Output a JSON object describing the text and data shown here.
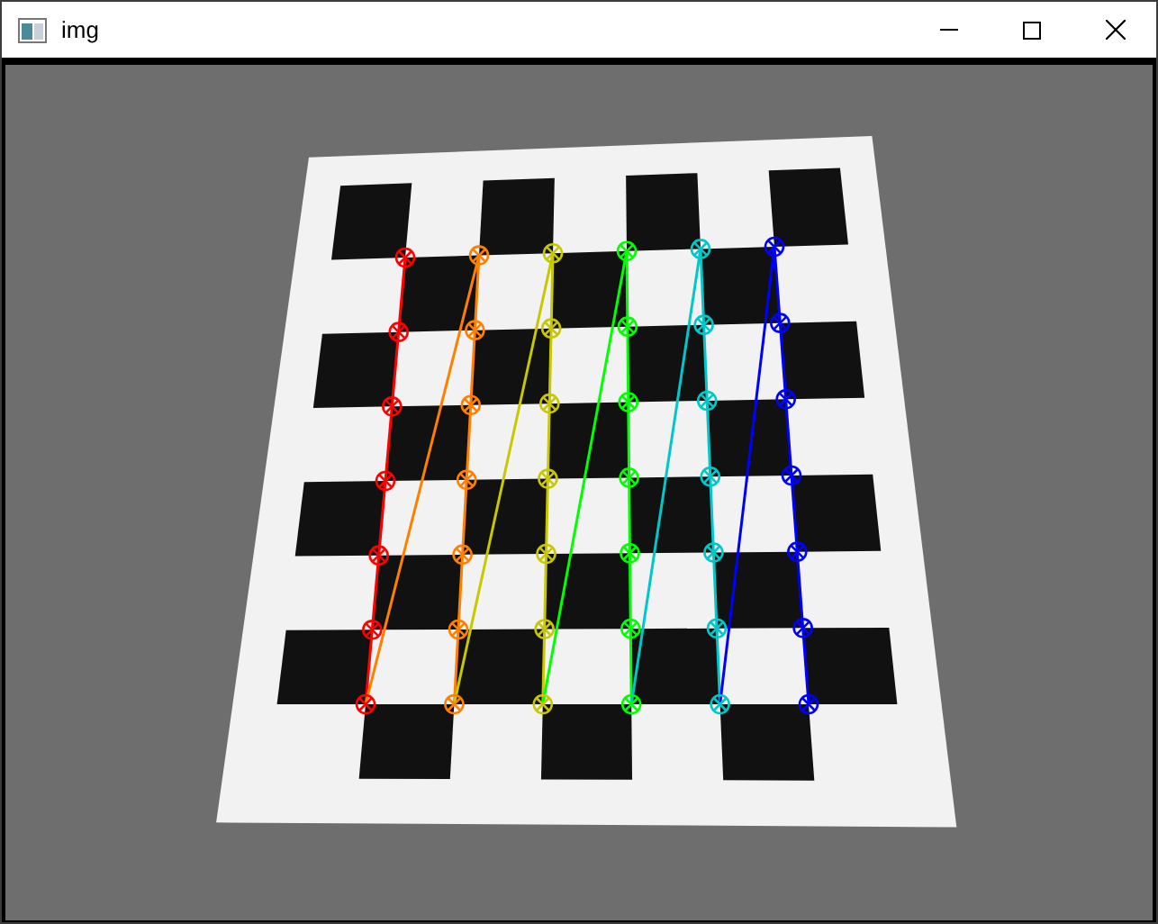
{
  "window": {
    "title": "img"
  }
}
